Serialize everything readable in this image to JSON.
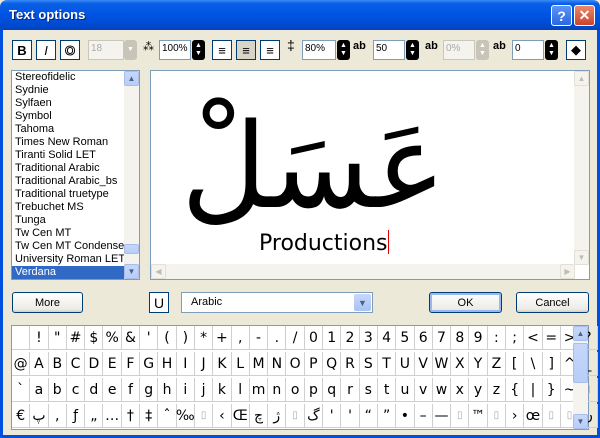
{
  "window": {
    "title": "Text options",
    "help_label": "?",
    "close_label": "✕"
  },
  "toolbar": {
    "bold_label": "B",
    "italic_label": "I",
    "outline_label": "O",
    "font_size_value": "18",
    "scale_value": "100%",
    "line_spacing_value": "80%",
    "char_spacing_value": "50",
    "baseline_value": "0%",
    "kerning_value": "0"
  },
  "font_list": {
    "items": [
      "Stereofidelic",
      "Sydnie",
      "Sylfaen",
      "Symbol",
      "Tahoma",
      "Times New Roman",
      "Tiranti Solid LET",
      "Traditional Arabic",
      "Traditional Arabic_bs",
      "Traditional truetype",
      "Trebuchet MS",
      "Tunga",
      "Tw Cen MT",
      "Tw Cen MT Condense",
      "University Roman LET",
      "Verdana"
    ],
    "selected": "Verdana"
  },
  "preview": {
    "arabic_text": "عَسَلْ",
    "latin_text": "Productions"
  },
  "controls": {
    "more_label": "More",
    "unicode_label": "U",
    "script_selected": "Arabic",
    "ok_label": "OK",
    "cancel_label": "Cancel"
  },
  "charmap": {
    "rows": [
      [
        " ",
        "!",
        "\"",
        "#",
        "$",
        "%",
        "&",
        "'",
        "(",
        ")",
        "*",
        "+",
        ",",
        "-",
        ".",
        "/",
        "0",
        "1",
        "2",
        "3",
        "4",
        "5",
        "6",
        "7",
        "8",
        "9",
        ":",
        ";",
        "<",
        "=",
        ">",
        "?"
      ],
      [
        "@",
        "A",
        "B",
        "C",
        "D",
        "E",
        "F",
        "G",
        "H",
        "I",
        "J",
        "K",
        "L",
        "M",
        "N",
        "O",
        "P",
        "Q",
        "R",
        "S",
        "T",
        "U",
        "V",
        "W",
        "X",
        "Y",
        "Z",
        "[",
        "\\",
        "]",
        "^",
        "_"
      ],
      [
        "`",
        "a",
        "b",
        "c",
        "d",
        "e",
        "f",
        "g",
        "h",
        "i",
        "j",
        "k",
        "l",
        "m",
        "n",
        "o",
        "p",
        "q",
        "r",
        "s",
        "t",
        "u",
        "v",
        "w",
        "x",
        "y",
        "z",
        "{",
        "|",
        "}",
        "~",
        "▯"
      ],
      [
        "€",
        "پ",
        ",",
        "ƒ",
        "„",
        "…",
        "†",
        "‡",
        "ˆ",
        "‰",
        "▯",
        "‹",
        "Œ",
        "چ",
        "ژ",
        "▯",
        "گ",
        "'",
        "'",
        "“",
        "”",
        "•",
        "–",
        "—",
        "▯",
        "™",
        "▯",
        "›",
        "œ",
        "▯",
        "▯",
        "ں"
      ]
    ]
  }
}
